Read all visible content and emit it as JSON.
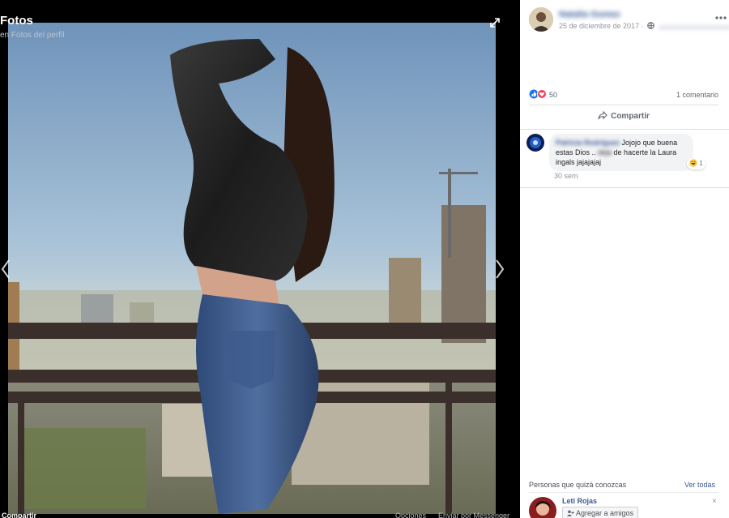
{
  "viewer": {
    "title": "Fotos",
    "subtitle": "en Fotos del perfil",
    "footer": {
      "share_label": "Compartir",
      "options_label": "Opciones",
      "messenger_label": "Enviar por Messenger"
    }
  },
  "post": {
    "author": "Natalia Gomez",
    "date": "25 de diciembre de 2017 ·",
    "reactions_count": "50",
    "comments_count": "1 comentario",
    "share_label": "Compartir"
  },
  "comment": {
    "author": "Patricia Rodríguez",
    "text_start": "Jojojo que buena estas Dios .. ",
    "text_blurred": "deja",
    "text_end": " de hacerte la Laura ingals jajajajaj",
    "reaction_count": "1",
    "time": "30 sem"
  },
  "pymk": {
    "title": "Personas que quizá conozcas",
    "see_all": "Ver todas",
    "person_name": "Leti Rojas",
    "add_label": "Agregar a amigos",
    "close_label": "×"
  },
  "colors": {
    "link": "#385898",
    "like_blue": "#1877f2",
    "love_red": "#f33e58"
  },
  "icons": [
    "expand-icon",
    "chevron-left-icon",
    "chevron-right-icon",
    "globe-icon",
    "more-options-icon",
    "like-icon",
    "love-icon",
    "share-icon",
    "haha-icon",
    "add-friend-icon"
  ]
}
